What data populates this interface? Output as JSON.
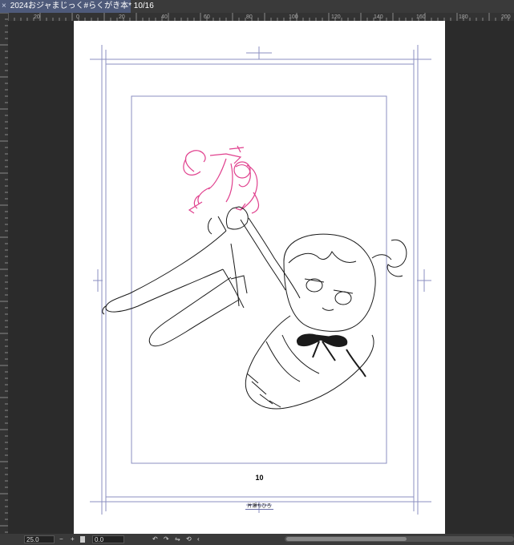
{
  "tab": {
    "close_glyph": "×",
    "title": "2024おジャまじっく#らくがき本* 10/16"
  },
  "ruler": {
    "top_labels": [
      "20",
      "0",
      "20",
      "40",
      "60",
      "80",
      "100",
      "120",
      "140",
      "160",
      "180",
      "200"
    ]
  },
  "page": {
    "page_number": "10",
    "author": "片瀬ちひろ"
  },
  "statusbar": {
    "zoom": "25.0",
    "zoom_minus": "−",
    "zoom_plus": "+",
    "rotation": "0.0",
    "icons": [
      "brush-size-marker-icon",
      "rotate-left-icon",
      "rotate-right-icon",
      "reset-icon",
      "scroll-left-icon"
    ]
  },
  "colors": {
    "sketch": "#e0418e",
    "guide": "#8b8fc0",
    "lineart": "#1a1a1a"
  }
}
